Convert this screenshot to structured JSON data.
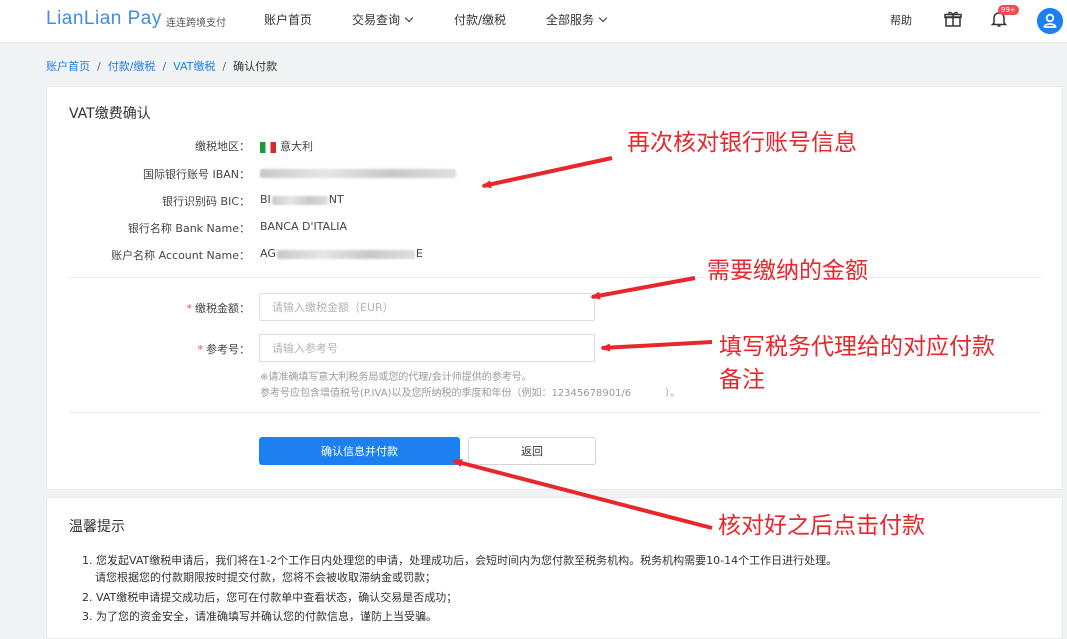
{
  "header": {
    "logo": "LianLian Pay",
    "logo_sub": "连连跨境支付",
    "nav": [
      "账户首页",
      "交易查询",
      "付款/缴税",
      "全部服务"
    ],
    "help": "帮助",
    "badge": "99+"
  },
  "breadcrumb": [
    "账户首页",
    "付款/缴税",
    "VAT缴税",
    "确认付款"
  ],
  "card": {
    "title": "VAT缴费确认",
    "fields": [
      {
        "label": "缴税地区：",
        "value": "意大利"
      },
      {
        "label": "国际银行账号 IBAN：",
        "value": ""
      },
      {
        "label": "银行识别码 BIC：",
        "value_prefix": "BI",
        "value_suffix": "NT"
      },
      {
        "label": "银行名称 Bank Name：",
        "value": "BANCA D'ITALIA"
      },
      {
        "label": "账户名称 Account Name：",
        "value_prefix": "AG",
        "value_suffix": "E"
      }
    ],
    "amount_label": "缴税金额：",
    "amount_placeholder": "请输入缴税金额（EUR）",
    "ref_label": "参考号：",
    "ref_placeholder": "请输入参考号",
    "note_line1": "※请准确填写意大利税务局或您的代理/会计师提供的参考号。",
    "note_line2": "参考号应包含增值税号(P.IVA)以及您所纳税的季度和年份（例如：12345678901/6",
    "note_tail": "）。",
    "confirm_button": "确认信息并付款",
    "back_button": "返回"
  },
  "tips": {
    "title": "温馨提示",
    "items": [
      "1. 您发起VAT缴税申请后，我们将在1-2个工作日内处理您的申请，处理成功后，会短时间内为您付款至税务机构。税务机构需要10-14个工作日进行处理。",
      "请您根据您的付款期限按时提交付款，您将不会被收取滞纳金或罚款；",
      "2. VAT缴税申请提交成功后，您可在付款单中查看状态，确认交易是否成功；",
      "3. 为了您的资金安全，请准确填写并确认您的付款信息，谨防上当受骗。"
    ]
  },
  "annotations": {
    "a1": "再次核对银行账号信息",
    "a2": "需要缴纳的金额",
    "a3_line1": "填写税务代理给的对应付款",
    "a3_line2": "备注",
    "a4": "核对好之后点击付款"
  },
  "colors": {
    "accent": "#1d80f0",
    "annotation": "#e8262b",
    "required": "#f14d4d"
  }
}
